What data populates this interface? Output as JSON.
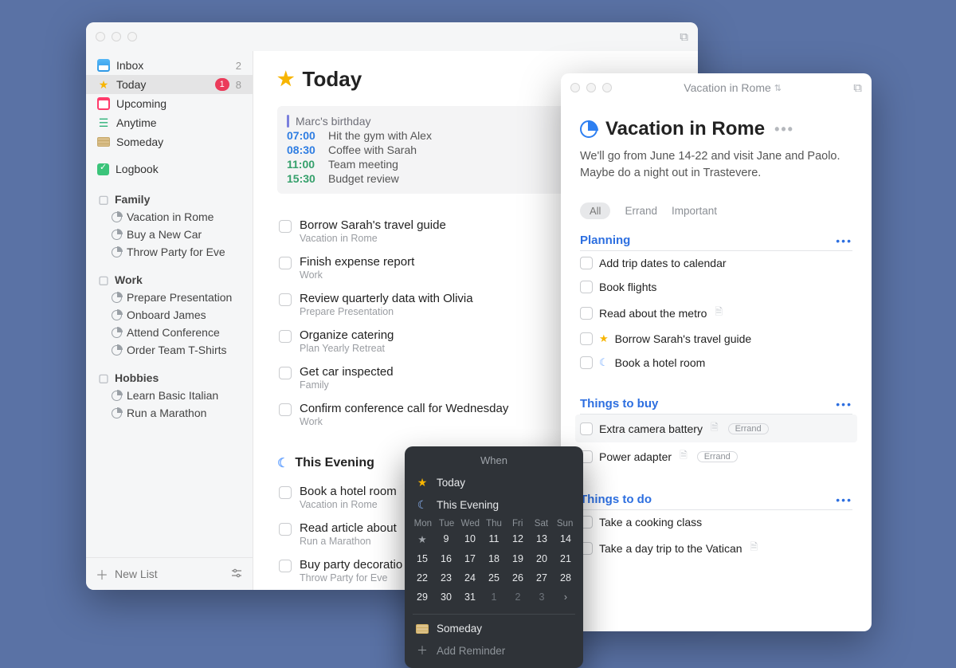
{
  "main": {
    "title": "Today",
    "schedule": [
      {
        "time": "",
        "text": "Marc's birthday",
        "color": "#6b70d6",
        "bar": true
      },
      {
        "time": "07:00",
        "text": "Hit the gym with Alex",
        "color": "#2f7de2"
      },
      {
        "time": "08:30",
        "text": "Coffee with Sarah",
        "color": "#2f7de2"
      },
      {
        "time": "11:00",
        "text": "Team meeting",
        "color": "#35a06b"
      },
      {
        "time": "15:30",
        "text": "Budget review",
        "color": "#35a06b"
      }
    ],
    "tasks": [
      {
        "title": "Borrow Sarah's travel guide",
        "sub": "Vacation in Rome"
      },
      {
        "title": "Finish expense report",
        "sub": "Work"
      },
      {
        "title": "Review quarterly data with Olivia",
        "sub": "Prepare Presentation"
      },
      {
        "title": "Organize catering",
        "sub": "Plan Yearly Retreat"
      },
      {
        "title": "Get car inspected",
        "sub": "Family"
      },
      {
        "title": "Confirm conference call for Wednesday",
        "sub": "Work"
      }
    ],
    "evening_title": "This Evening",
    "evening_tasks": [
      {
        "title": "Book a hotel room",
        "sub": "Vacation in Rome"
      },
      {
        "title": "Read article about",
        "sub": "Run a Marathon"
      },
      {
        "title": "Buy party decoratio",
        "sub": "Throw Party for Eve"
      }
    ]
  },
  "sidebar": {
    "top": [
      {
        "icon": "inbox",
        "label": "Inbox",
        "count": "2"
      },
      {
        "icon": "star",
        "label": "Today",
        "badge": "1",
        "count": "8",
        "selected": true
      },
      {
        "icon": "cal",
        "label": "Upcoming"
      },
      {
        "icon": "stack",
        "label": "Anytime"
      },
      {
        "icon": "drawer",
        "label": "Someday"
      }
    ],
    "logbook_label": "Logbook",
    "areas": [
      {
        "name": "Family",
        "projects": [
          "Vacation in Rome",
          "Buy a New Car",
          "Throw Party for Eve"
        ]
      },
      {
        "name": "Work",
        "projects": [
          "Prepare Presentation",
          "Onboard James",
          "Attend Conference",
          "Order Team T-Shirts"
        ]
      },
      {
        "name": "Hobbies",
        "projects": [
          "Learn Basic Italian",
          "Run a Marathon"
        ]
      }
    ],
    "new_list": "New List"
  },
  "project": {
    "titlebar": "Vacation in Rome",
    "heading": "Vacation in Rome",
    "desc": "We'll go from June 14-22 and visit Jane and Paolo. Maybe do a night out in Trastevere.",
    "filters": {
      "all": "All",
      "errand": "Errand",
      "important": "Important"
    },
    "sections": [
      {
        "name": "Planning",
        "tasks": [
          {
            "text": "Add trip dates to calendar"
          },
          {
            "text": "Book flights"
          },
          {
            "text": "Read about the metro",
            "note": true
          },
          {
            "text": "Borrow Sarah's travel guide",
            "star": true
          },
          {
            "text": "Book a hotel room",
            "moon": true
          }
        ]
      },
      {
        "name": "Things to buy",
        "tasks": [
          {
            "text": "Extra camera battery",
            "note": true,
            "tag": "Errand",
            "hl": true
          },
          {
            "text": "Power adapter",
            "note": true,
            "tag": "Errand"
          }
        ]
      },
      {
        "name": "Things to do",
        "tasks": [
          {
            "text": "Take a cooking class"
          },
          {
            "text": "Take a day trip to the Vatican",
            "note": true
          }
        ]
      }
    ]
  },
  "popover": {
    "title": "When",
    "today": "Today",
    "evening": "This Evening",
    "dow": [
      "Mon",
      "Tue",
      "Wed",
      "Thu",
      "Fri",
      "Sat",
      "Sun"
    ],
    "grid": [
      {
        "t": "★",
        "cls": "star"
      },
      {
        "t": "9"
      },
      {
        "t": "10"
      },
      {
        "t": "11"
      },
      {
        "t": "12"
      },
      {
        "t": "13"
      },
      {
        "t": "14"
      },
      {
        "t": "15"
      },
      {
        "t": "16"
      },
      {
        "t": "17"
      },
      {
        "t": "18"
      },
      {
        "t": "19"
      },
      {
        "t": "20"
      },
      {
        "t": "21"
      },
      {
        "t": "22"
      },
      {
        "t": "23"
      },
      {
        "t": "24"
      },
      {
        "t": "25"
      },
      {
        "t": "26"
      },
      {
        "t": "27"
      },
      {
        "t": "28"
      },
      {
        "t": "29"
      },
      {
        "t": "30"
      },
      {
        "t": "31"
      },
      {
        "t": "1",
        "cls": "dim"
      },
      {
        "t": "2",
        "cls": "dim"
      },
      {
        "t": "3",
        "cls": "dim"
      },
      {
        "t": "›",
        "cls": "nav"
      }
    ],
    "someday": "Someday",
    "add_reminder": "Add Reminder"
  }
}
